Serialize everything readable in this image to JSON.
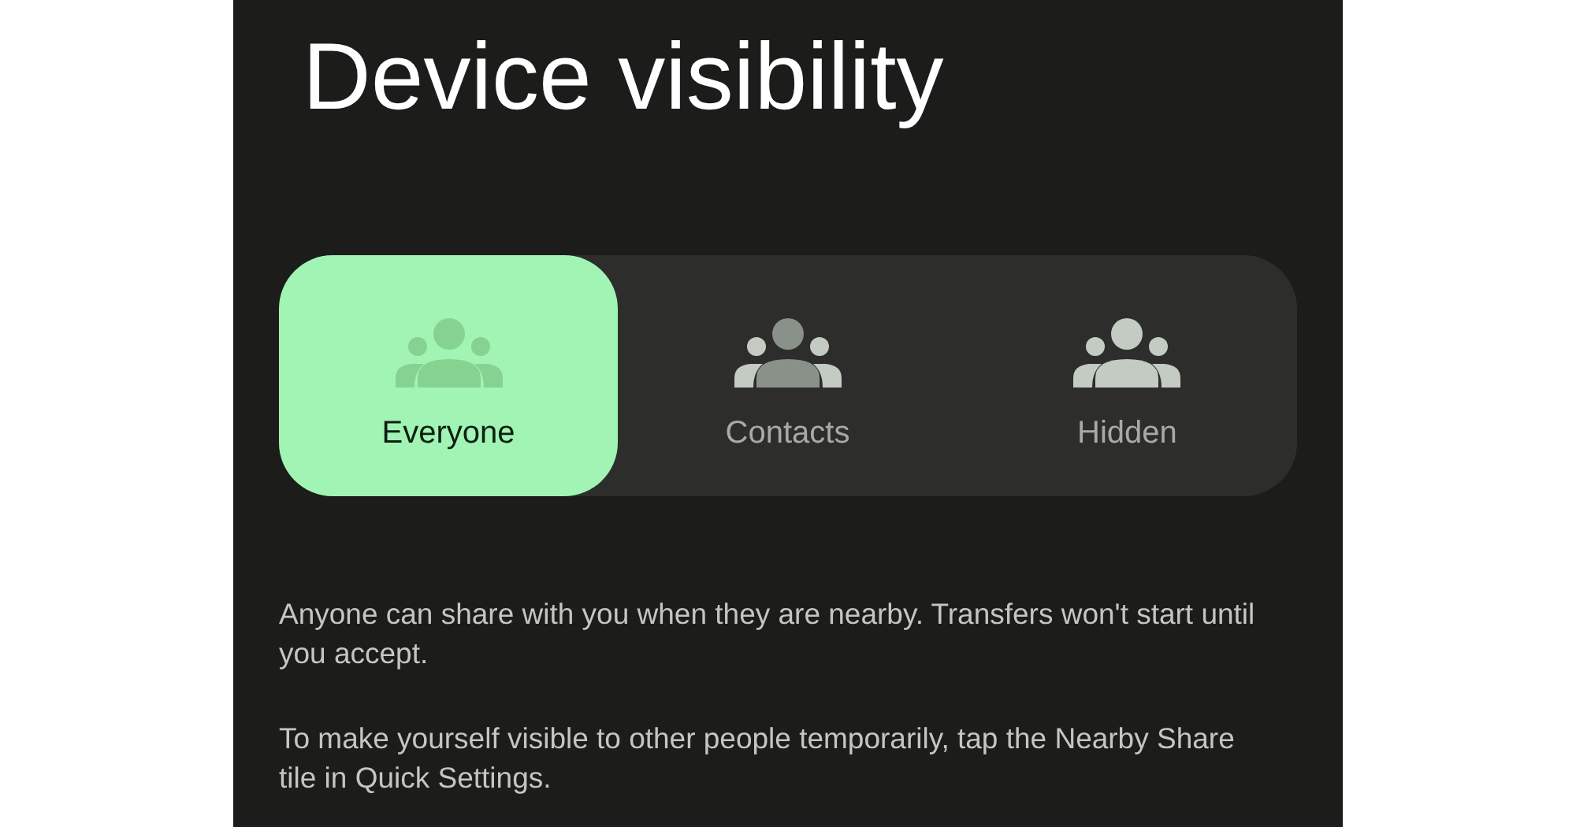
{
  "title": "Device visibility",
  "options": [
    {
      "label": "Everyone",
      "kind": "everyone",
      "selected": true
    },
    {
      "label": "Contacts",
      "kind": "contacts",
      "selected": false
    },
    {
      "label": "Hidden",
      "kind": "hidden",
      "selected": false
    }
  ],
  "paragraphs": [
    "Anyone can share with you when they are nearby. Transfers won't start until you accept.",
    "To make yourself visible to other people temporarily, tap the Nearby Share tile in Quick Settings."
  ]
}
